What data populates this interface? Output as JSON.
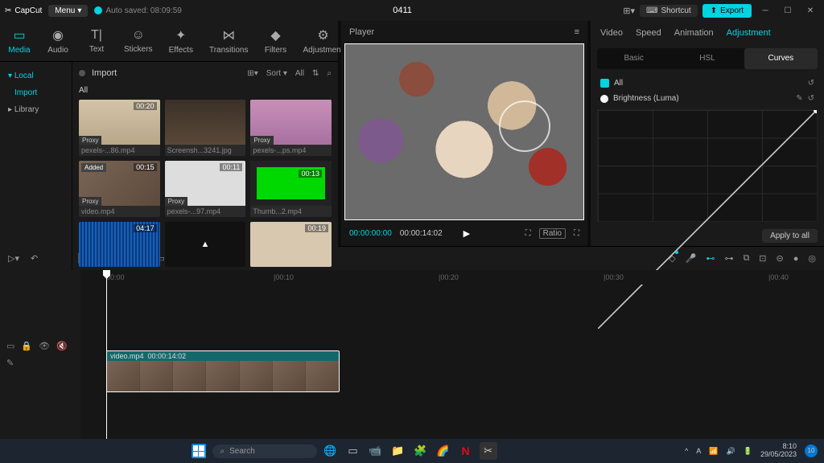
{
  "app": {
    "name": "CapCut",
    "menu": "Menu",
    "autosave": "Auto saved: 08:09:59",
    "title": "0411"
  },
  "titlebar": {
    "shortcut": "Shortcut",
    "export": "Export"
  },
  "tabs": [
    "Media",
    "Audio",
    "Text",
    "Stickers",
    "Effects",
    "Transitions",
    "Filters",
    "Adjustment"
  ],
  "sidebar": {
    "local": "Local",
    "import": "Import",
    "library": "Library"
  },
  "media": {
    "import": "Import",
    "sort": "Sort",
    "all": "All",
    "all_label": "All"
  },
  "thumbs": [
    {
      "dur": "00:20",
      "name": "pexels-...86.mp4",
      "proxy": true
    },
    {
      "dur": "",
      "name": "Screensh...3241.jpg",
      "proxy": false
    },
    {
      "dur": "",
      "name": "pexels-...ps.mp4",
      "proxy": true
    },
    {
      "dur": "00:15",
      "name": "video.mp4",
      "proxy": true,
      "badge": "Added"
    },
    {
      "dur": "00:11",
      "name": "pexels-...97.mp4",
      "proxy": true
    },
    {
      "dur": "00:13",
      "name": "Thumb...2.mp4",
      "proxy": false
    },
    {
      "dur": "04:17",
      "name": "",
      "proxy": false
    },
    {
      "dur": "",
      "name": "",
      "proxy": false
    },
    {
      "dur": "00:19",
      "name": "",
      "proxy": false
    }
  ],
  "player": {
    "label": "Player",
    "t1": "00:00:00:00",
    "t2": "00:00:14:02",
    "ratio": "Ratio"
  },
  "adjust": {
    "tabs": [
      "Video",
      "Speed",
      "Animation",
      "Adjustment"
    ],
    "sub": [
      "Basic",
      "HSL",
      "Curves"
    ],
    "all": "All",
    "brightness": "Brightness (Luma)",
    "apply": "Apply to all"
  },
  "ruler": [
    "00:00",
    "|00:10",
    "|00:20",
    "|00:30",
    "|00:40"
  ],
  "clip": {
    "name": "video.mp4",
    "dur": "00:00:14:02"
  },
  "taskbar": {
    "search": "Search",
    "time": "8:10",
    "date": "29/05/2023"
  }
}
